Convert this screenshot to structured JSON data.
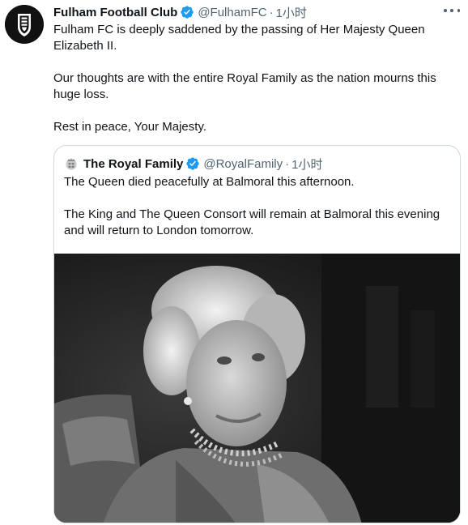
{
  "tweet": {
    "author": {
      "display_name": "Fulham Football Club",
      "handle": "@FulhamFC",
      "avatar_icon": "fulham-crest-icon"
    },
    "separator": "·",
    "time": "1小时",
    "text": {
      "line1": "Fulham FC is deeply saddened by the passing of Her Majesty Queen Elizabeth II.",
      "line2": "Our thoughts are with the entire Royal Family as the nation mourns this huge loss.",
      "line3": "Rest in peace, Your Majesty."
    },
    "more_icon": "more-options-icon",
    "verified_icon": "verified-badge-icon"
  },
  "quoted": {
    "author": {
      "display_name": "The Royal Family",
      "handle": "@RoyalFamily",
      "avatar_icon": "royal-crest-icon"
    },
    "separator": "·",
    "time": "1小时",
    "text": {
      "line1": "The Queen died peacefully at Balmoral this afternoon.",
      "line2": "The King and The Queen Consort will remain at Balmoral this evening and will return to London tomorrow."
    },
    "media": {
      "type": "photo",
      "style": "black-and-white portrait"
    }
  },
  "colors": {
    "text": "#0f1419",
    "secondary": "#536471",
    "verified": "#1d9bf0",
    "border": "#cfd9de"
  }
}
